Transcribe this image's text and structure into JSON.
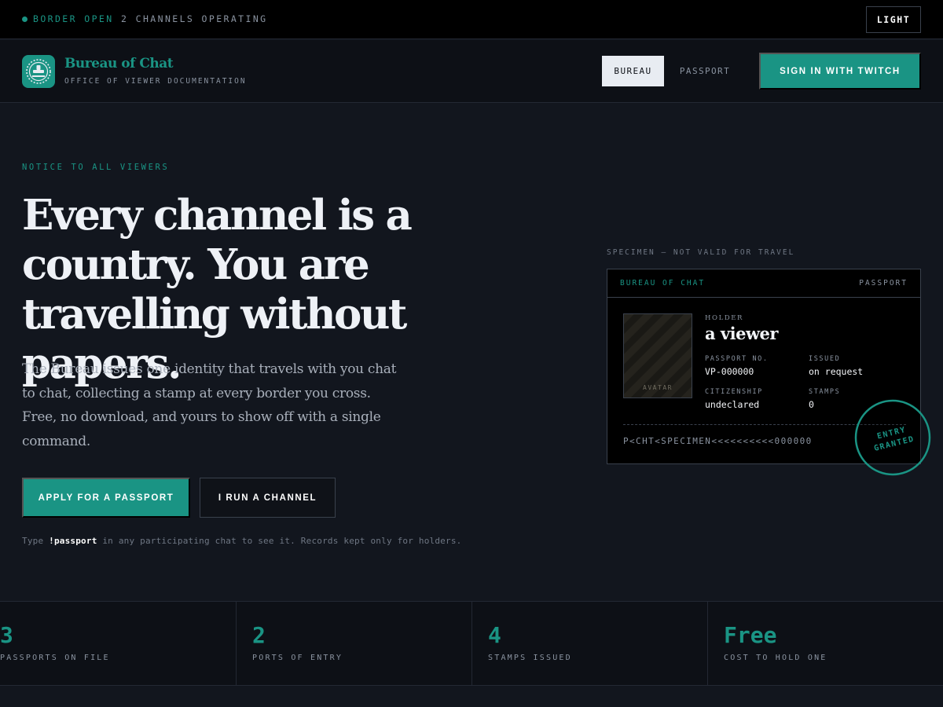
{
  "status_bar": {
    "border_status": "BORDER OPEN",
    "channels": "2 CHANNELS OPERATING",
    "theme_toggle": "LIGHT"
  },
  "header": {
    "brand": "Bureau of Chat",
    "subtitle": "OFFICE OF VIEWER DOCUMENTATION",
    "nav": [
      "BUREAU",
      "PASSPORT"
    ],
    "active_nav": "BUREAU",
    "cta": "SIGN IN WITH TWITCH"
  },
  "hero": {
    "eyebrow": "NOTICE TO ALL VIEWERS",
    "headline": "Every channel is a country. You are travelling without papers.",
    "lede": "The Bureau issues one identity that travels with you chat to chat, collecting a stamp at every border you cross. Free, no download, and yours to show off with a single command.",
    "primary_button": "APPLY FOR A PASSPORT",
    "secondary_button": "I RUN A CHANNEL",
    "hint_before": "Type",
    "hint_command": "!passport",
    "hint_after": "in any participating chat to see it. Records kept only for holders."
  },
  "passport": {
    "specimen_label": "SPECIMEN — NOT VALID FOR TRAVEL",
    "issuer": "BUREAU OF CHAT",
    "doc_type": "PASSPORT",
    "photo_label": "AVATAR",
    "holder_label": "HOLDER",
    "holder_name": "a viewer",
    "passport_no_label": "PASSPORT NO.",
    "passport_no": "VP-000000",
    "issued_label": "ISSUED",
    "issued": "on request",
    "citizenship_label": "CITIZENSHIP",
    "citizenship": "undeclared",
    "stamps_label": "STAMPS",
    "stamps": "0",
    "mrz": "P<CHT<SPECIMEN<<<<<<<<<<000000",
    "stamp_line1": "ENTRY",
    "stamp_line2": "GRANTED"
  },
  "stats": [
    {
      "value": "3",
      "label": "PASSPORTS ON FILE"
    },
    {
      "value": "2",
      "label": "PORTS OF ENTRY"
    },
    {
      "value": "4",
      "label": "STAMPS ISSUED"
    },
    {
      "value": "Free",
      "label": "COST TO HOLD ONE"
    }
  ],
  "colors": {
    "accent": "#1a9484",
    "background": "#12161e",
    "bar": "#000000"
  }
}
